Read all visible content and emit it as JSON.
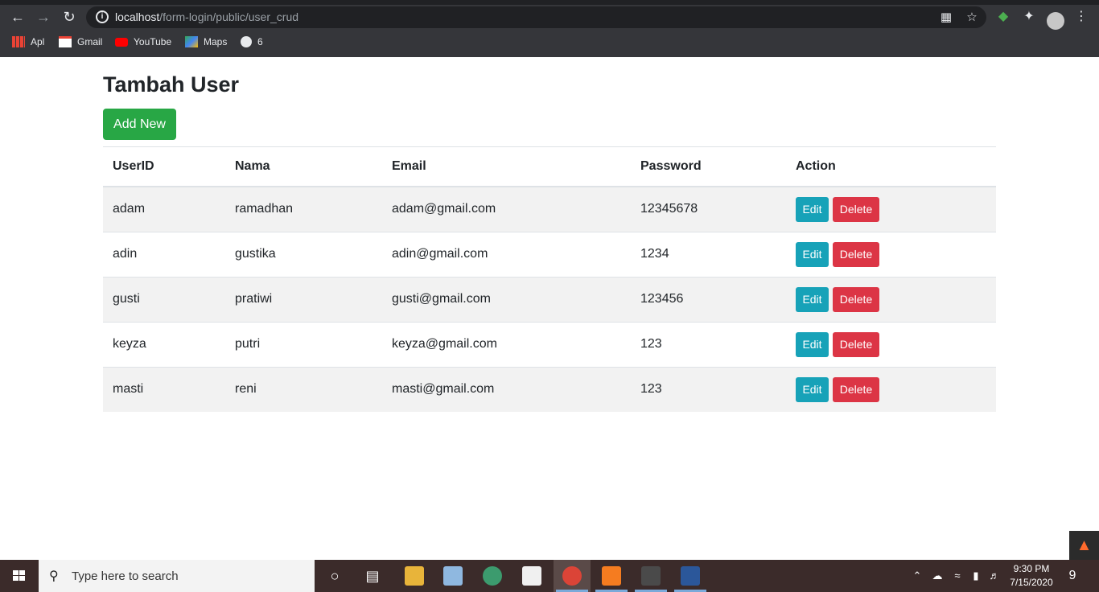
{
  "browser": {
    "url_host": "localhost",
    "url_path": "/form-login/public/user_crud",
    "bookmarks": [
      {
        "label": "Apl"
      },
      {
        "label": "Gmail"
      },
      {
        "label": "YouTube"
      },
      {
        "label": "Maps"
      },
      {
        "label": "6"
      }
    ]
  },
  "page": {
    "title": "Tambah User",
    "add_button": "Add New",
    "columns": [
      "UserID",
      "Nama",
      "Email",
      "Password",
      "Action"
    ],
    "rows": [
      {
        "userid": "adam",
        "nama": "ramadhan",
        "email": "adam@gmail.com",
        "password": "12345678"
      },
      {
        "userid": "adin",
        "nama": "gustika",
        "email": "adin@gmail.com",
        "password": "1234"
      },
      {
        "userid": "gusti",
        "nama": "pratiwi",
        "email": "gusti@gmail.com",
        "password": "123456"
      },
      {
        "userid": "keyza",
        "nama": "putri",
        "email": "keyza@gmail.com",
        "password": "123"
      },
      {
        "userid": "masti",
        "nama": "reni",
        "email": "masti@gmail.com",
        "password": "123"
      }
    ],
    "edit_label": "Edit",
    "delete_label": "Delete"
  },
  "taskbar": {
    "search_placeholder": "Type here to search",
    "time": "9:30 PM",
    "date": "7/15/2020",
    "notification_count": "9"
  },
  "colors": {
    "add_button": "#28a745",
    "edit_button": "#17a2b8",
    "delete_button": "#dc3545"
  }
}
